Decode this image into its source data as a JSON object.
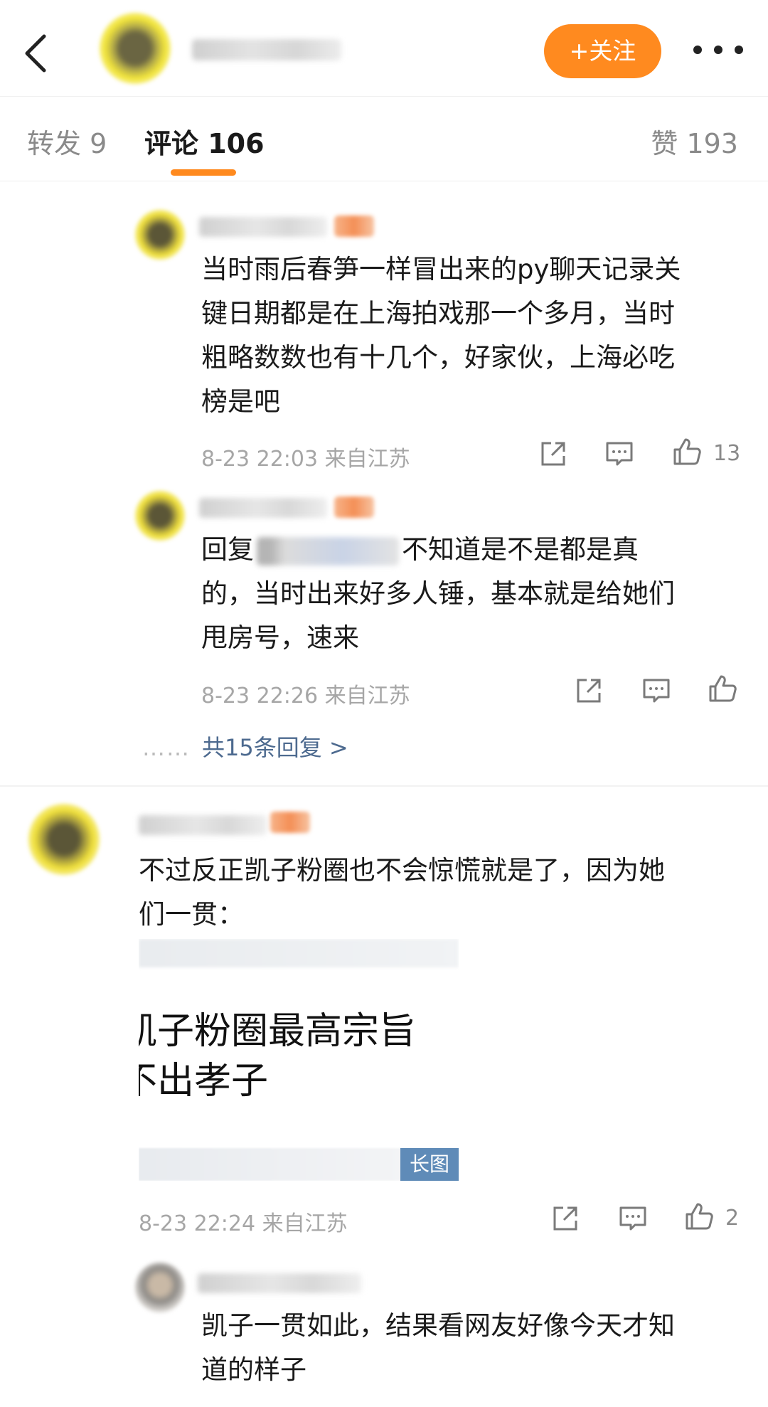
{
  "header": {
    "follow_label": "+关注"
  },
  "tabs": {
    "repost": "转发 9",
    "comment": "评论 106",
    "like": "赞 193"
  },
  "comments": [
    {
      "text_lines": [
        "当时雨后春笋一样冒出来的py聊天记录关",
        "键日期都是在上海拍戏那一个多月，当时",
        "粗略数数也有十几个，好家伙，上海必吃",
        "榜是吧"
      ],
      "meta": "8-23 22:03 来自江苏",
      "likes": "13"
    },
    {
      "reply_prefix": "回复",
      "text_lines": [
        "不知道是不是都是真",
        "的，当时出来好多人锤，基本就是给她们",
        "甩房号，速来"
      ],
      "meta": "8-23 22:26 来自江苏"
    },
    {
      "more_replies": "共15条回复 >",
      "dots": "……"
    },
    {
      "text_lines": [
        "不过反正凯子粉圈也不会惊慌就是了，因为她",
        "们一贯："
      ],
      "image_lines": [
        "凯子粉圈最高宗旨",
        "不出孝子"
      ],
      "image_badge": "长图",
      "meta": "8-23 22:24 来自江苏",
      "likes": "2"
    },
    {
      "text_lines": [
        "凯子一贯如此，结果看网友好像今天才知",
        "道的样子"
      ]
    }
  ],
  "icons": {
    "back": "chevron-left-icon",
    "more": "more-horizontal-icon",
    "share": "share-icon",
    "comment": "comment-icon",
    "like": "thumbs-up-icon"
  },
  "colors": {
    "accent": "#ff8a1f",
    "link": "#4d6a8f",
    "meta": "#a6a6a6",
    "badge": "#5f8bb8"
  }
}
